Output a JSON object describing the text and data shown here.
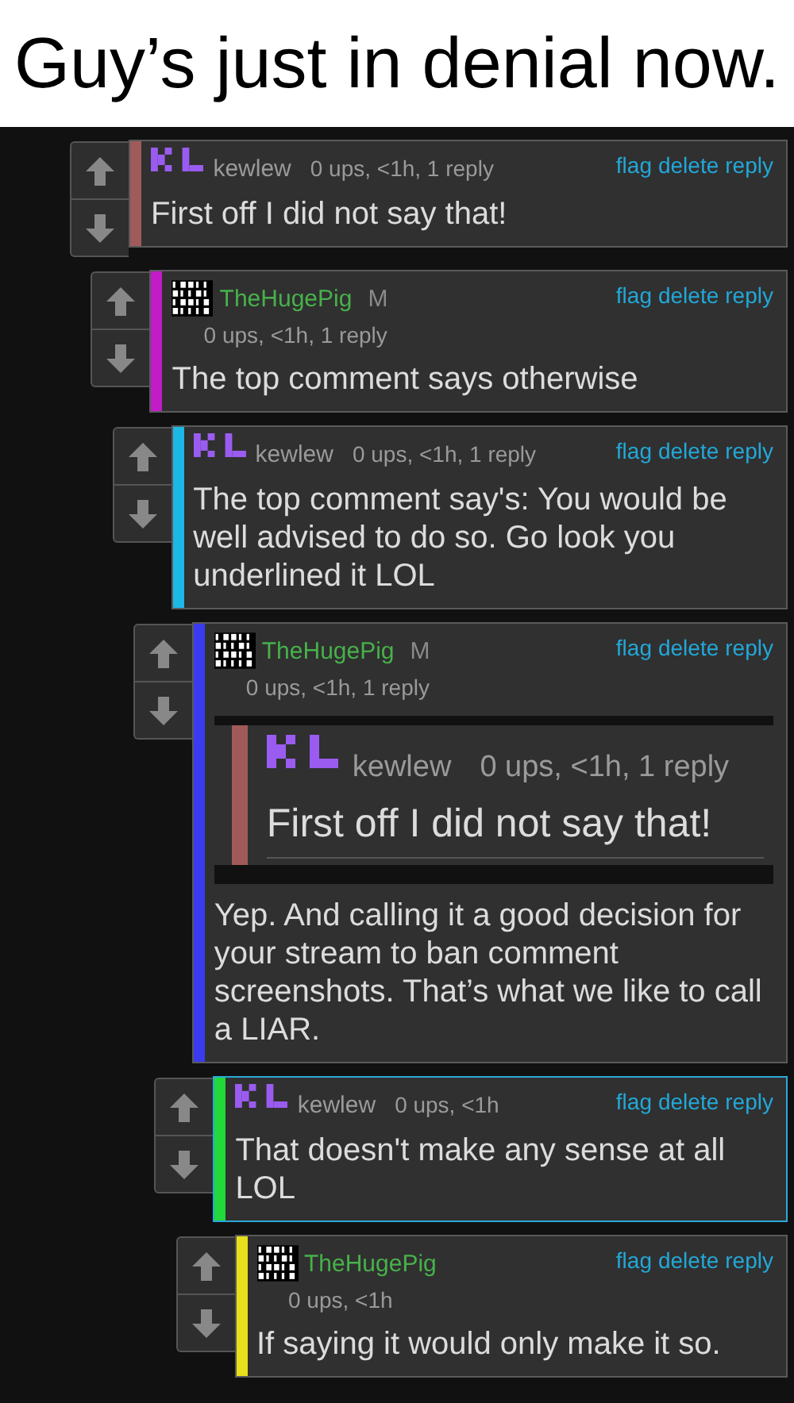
{
  "title": "Guy’s just in denial now.",
  "comments": [
    {
      "kind": "inline",
      "username": "kewlew",
      "meta": "0 ups, <1h, 1 reply",
      "color": "#a05a5a",
      "highlighted": false,
      "actions": [
        "flag",
        "delete",
        "reply"
      ],
      "text": "First off I did not say that!",
      "children": [
        {
          "kind": "stacked",
          "username": "TheHugePig",
          "badge": "M",
          "meta": "0 ups, <1h, 1 reply",
          "color": "#c21bc8",
          "highlighted": false,
          "actions": [
            "flag",
            "delete",
            "reply"
          ],
          "text": "The top comment says otherwise",
          "children": [
            {
              "kind": "inline",
              "username": "kewlew",
              "meta": "0 ups, <1h, 1 reply",
              "color": "#1cb8e6",
              "highlighted": false,
              "actions": [
                "flag",
                "delete",
                "reply"
              ],
              "text": "The top comment say's: You would be well advised to do so. Go look you underlined it LOL",
              "children": [
                {
                  "kind": "stacked",
                  "username": "TheHugePig",
                  "badge": "M",
                  "meta": "0 ups, <1h, 1 reply",
                  "color": "#3a3af0",
                  "highlighted": false,
                  "actions": [
                    "flag",
                    "delete",
                    "reply"
                  ],
                  "quote": {
                    "kind": "inline",
                    "username": "kewlew",
                    "meta": "0 ups, <1h, 1 reply",
                    "color": "#a05a5a",
                    "text": "First off I did not say that!"
                  },
                  "text": "Yep. And calling it a good decision for your stream to ban comment screenshots. That’s what we like to call a LIAR.",
                  "children": [
                    {
                      "kind": "inline",
                      "username": "kewlew",
                      "meta": "0 ups, <1h",
                      "color": "#22d83a",
                      "highlighted": true,
                      "actions": [
                        "flag",
                        "delete",
                        "reply"
                      ],
                      "text": "That doesn't make any sense at all LOL",
                      "children": [
                        {
                          "kind": "stacked",
                          "username": "TheHugePig",
                          "meta": "0 ups, <1h",
                          "color": "#e8e01a",
                          "highlighted": false,
                          "actions": [
                            "flag",
                            "delete",
                            "reply"
                          ],
                          "text": "If saying it would only make it so."
                        }
                      ]
                    }
                  ]
                }
              ]
            }
          ]
        }
      ]
    }
  ]
}
